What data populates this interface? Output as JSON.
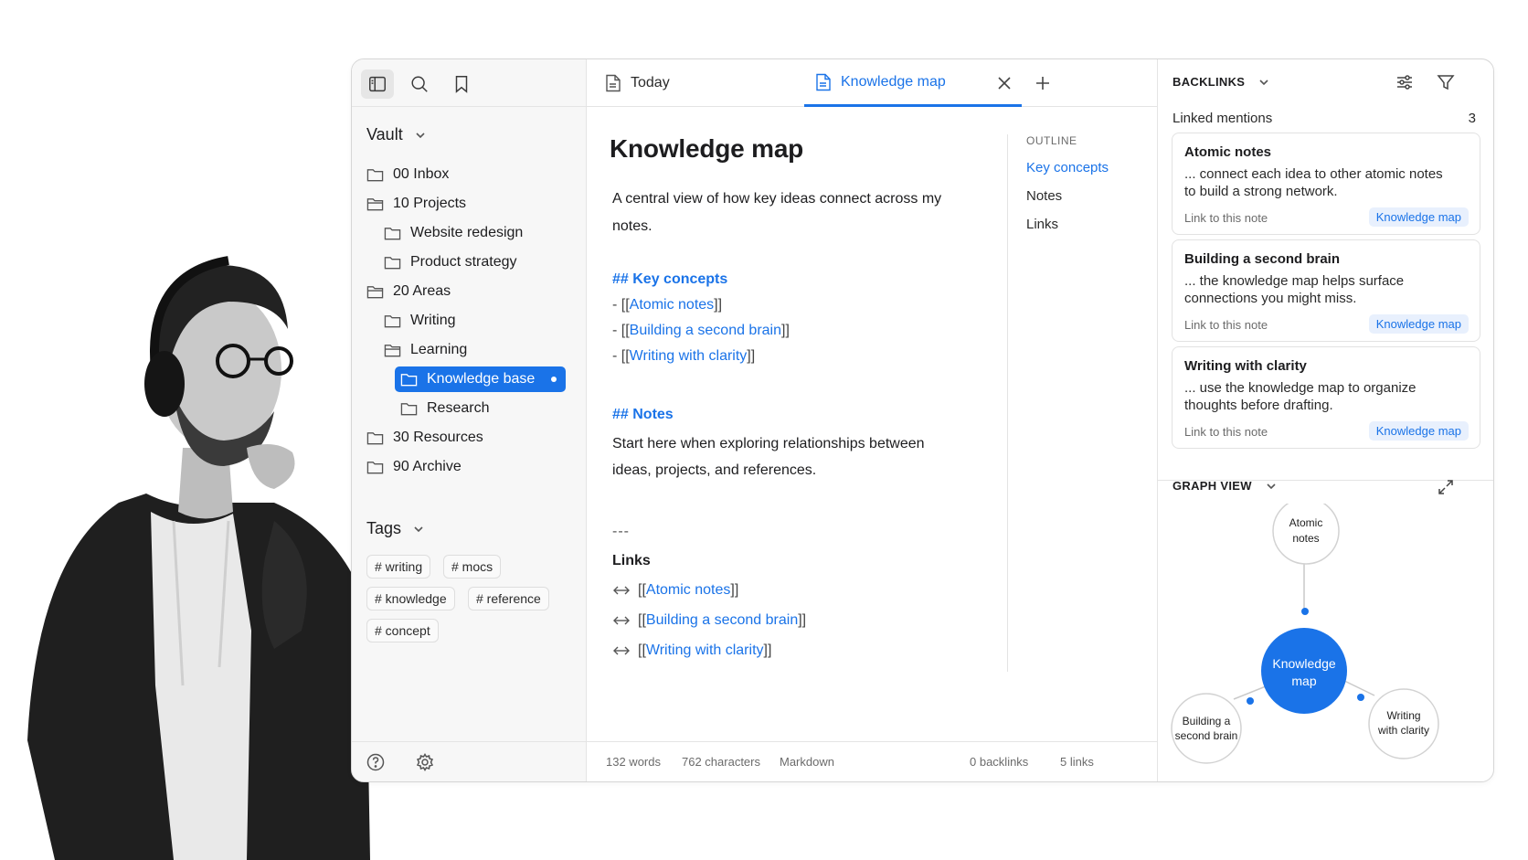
{
  "sidebar": {
    "vault_label": "Vault",
    "tree": [
      {
        "label": "00 Inbox"
      },
      {
        "label": "10 Projects"
      },
      {
        "label": "Website redesign"
      },
      {
        "label": "Product strategy"
      },
      {
        "label": "20 Areas"
      },
      {
        "label": "Writing"
      },
      {
        "label": "Learning"
      },
      {
        "label": "Knowledge base"
      },
      {
        "label": "Research"
      },
      {
        "label": "30 Resources"
      },
      {
        "label": "90 Archive"
      }
    ],
    "tags_label": "Tags",
    "tags": [
      "# writing",
      "# mocs",
      "# knowledge",
      "# reference",
      "# concept"
    ]
  },
  "tabs": [
    {
      "label": "Today"
    },
    {
      "label": "Knowledge map"
    }
  ],
  "document": {
    "title": "Knowledge map",
    "intro": "A central view of how key ideas connect across my notes.",
    "key_concepts_heading": "## Key concepts",
    "key_concepts": [
      {
        "prefix": "- [[",
        "link": "Atomic notes",
        "suffix": "]]"
      },
      {
        "prefix": "- [[",
        "link": "Building a second brain",
        "suffix": "]]"
      },
      {
        "prefix": "- [[",
        "link": "Writing with clarity",
        "suffix": "]]"
      }
    ],
    "notes_heading": "## Notes",
    "notes_text": "Start here when exploring relationships between ideas, projects, and references.",
    "hr": "---",
    "links_heading": "Links",
    "links": [
      {
        "prefix": "[[",
        "link": "Atomic notes",
        "suffix": "]]"
      },
      {
        "prefix": "[[",
        "link": "Building a second brain",
        "suffix": "]]"
      },
      {
        "prefix": "[[",
        "link": "Writing with clarity",
        "suffix": "]]"
      }
    ]
  },
  "outline": {
    "heading": "OUTLINE",
    "items": [
      "Key concepts",
      "Notes",
      "Links"
    ]
  },
  "status": {
    "words": "132 words",
    "characters": "762 characters",
    "format": "Markdown",
    "backlinks": "0 backlinks",
    "links": "5 links"
  },
  "backlinks": {
    "heading": "BACKLINKS",
    "linked_mentions": "Linked mentions",
    "count": "3",
    "cards": [
      {
        "title": "Atomic notes",
        "text": "... connect each idea to other atomic notes to build a strong network.",
        "foot": "Link to this note",
        "badge": "Knowledge map"
      },
      {
        "title": "Building a second brain",
        "text": "... the knowledge map helps surface connections you might miss.",
        "foot": "Link to this note",
        "badge": "Knowledge map"
      },
      {
        "title": "Writing with clarity",
        "text": "... use the knowledge map to organize thoughts before drafting.",
        "foot": "Link to this note",
        "badge": "Knowledge map"
      }
    ]
  },
  "graph": {
    "heading": "GRAPH VIEW",
    "center": [
      "Knowledge",
      "map"
    ],
    "top": [
      "Atomic",
      "notes"
    ],
    "left": [
      "Building a",
      "second brain"
    ],
    "right": [
      "Writing",
      "with clarity"
    ]
  },
  "colors": {
    "accent": "#1a73e8",
    "border": "#e4e4e4",
    "sidebar_bg": "#f7f7f7"
  }
}
